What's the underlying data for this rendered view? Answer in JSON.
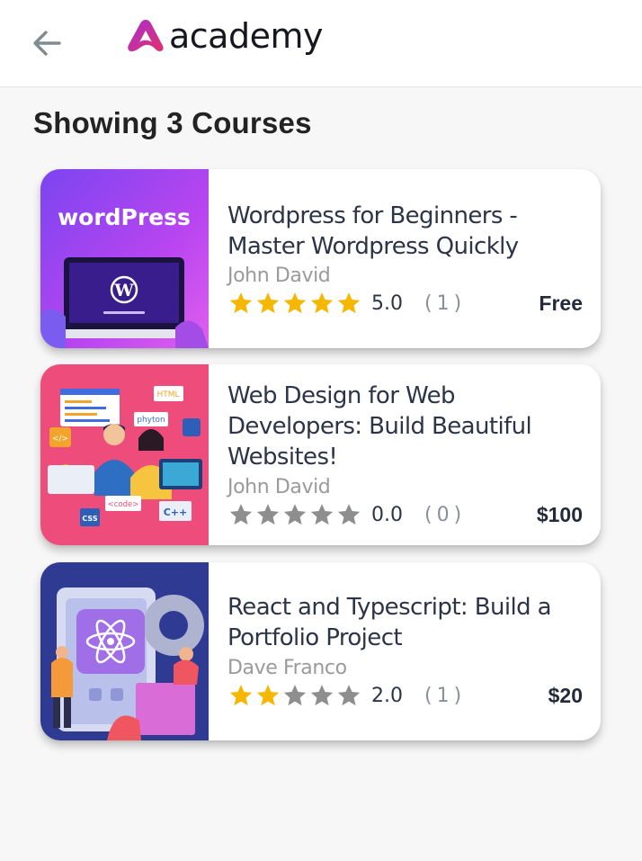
{
  "header": {
    "back_icon": "arrow-left-icon",
    "logo_text": "academy"
  },
  "page_title": "Showing 3 Courses",
  "colors": {
    "star_filled": "#f5b700",
    "star_empty": "#8e8e8e",
    "title": "#2c3548",
    "muted": "#9a9a9a"
  },
  "courses": [
    {
      "title_lines": [
        "Wordpress for Beginners -",
        "Master Wordpress Quickly"
      ],
      "thumb_text": "wordPress",
      "instructor": "John David",
      "stars_filled": 5,
      "rating": "5.0",
      "reviews": "(1)",
      "price": "Free"
    },
    {
      "title_lines": [
        "Web Design for Web",
        "Developers: Build Beautiful",
        "Websites!"
      ],
      "thumb_labels": [
        "HTML",
        "phyton",
        "</>",
        "<code>",
        "C++",
        "CSS"
      ],
      "instructor": "John David",
      "stars_filled": 0,
      "rating": "0.0",
      "reviews": "(0)",
      "price": "$100"
    },
    {
      "title_lines": [
        "React and Typescript: Build a",
        "Portfolio Project"
      ],
      "instructor": "Dave Franco",
      "stars_filled": 2,
      "rating": "2.0",
      "reviews": "(1)",
      "price": "$20"
    }
  ]
}
